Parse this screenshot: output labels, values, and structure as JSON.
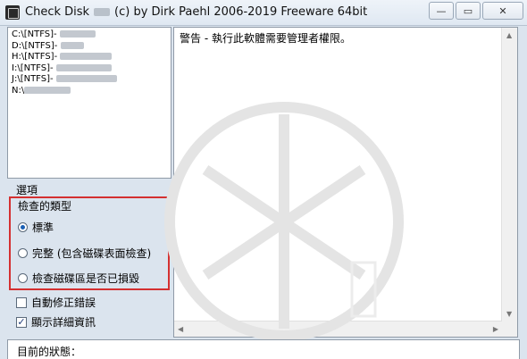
{
  "window": {
    "title_prefix": "Check Disk",
    "title_suffix": "(c) by Dirk Paehl  2006-2019 Freeware 64bit",
    "minimize_glyph": "—",
    "maximize_glyph": "▭",
    "close_glyph": "✕"
  },
  "drives": [
    {
      "label": "C:\\[NTFS]- ",
      "name_width": 40
    },
    {
      "label": "D:\\[NTFS]- ",
      "name_width": 26
    },
    {
      "label": "H:\\[NTFS]- ",
      "name_width": 58
    },
    {
      "label": "I:\\[NTFS]- ",
      "name_width": 62
    },
    {
      "label": "J:\\[NTFS]- ",
      "name_width": 68
    },
    {
      "label": "N:\\",
      "name_width": 52
    }
  ],
  "options": {
    "title": "選項",
    "check_type_title": "檢查的類型",
    "radios": [
      {
        "label": "標準",
        "checked": true
      },
      {
        "label": "完整 (包含磁碟表面檢查)",
        "checked": false
      },
      {
        "label": "檢查磁碟區是否已損毀",
        "checked": false
      }
    ],
    "checkboxes": [
      {
        "label": "自動修正錯誤",
        "checked": false
      },
      {
        "label": "顯示詳細資訊",
        "checked": true
      }
    ]
  },
  "log": {
    "message": "警告 - 執行此軟體需要管理者權限。"
  },
  "status": {
    "label": "目前的狀態："
  },
  "colors": {
    "highlight_border": "#d43030",
    "window_bg": "#dbe4ee"
  }
}
